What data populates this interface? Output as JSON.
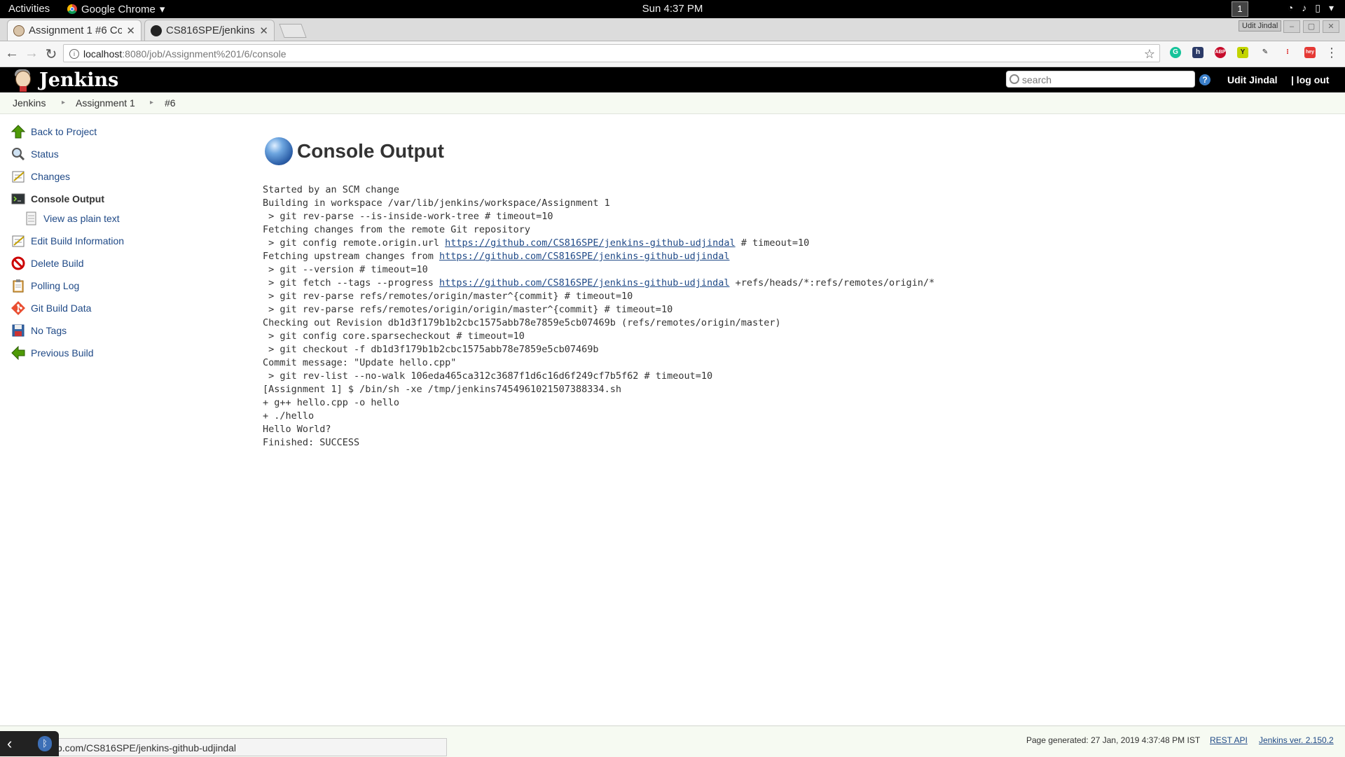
{
  "os_topbar": {
    "activities": "Activities",
    "app_name": "Google Chrome",
    "clock": "Sun  4:37 PM",
    "workspace": "1"
  },
  "browser": {
    "tabs": [
      {
        "title": "Assignment 1 #6 Co",
        "active": true
      },
      {
        "title": "CS816SPE/jenkins-¨",
        "active": false
      }
    ],
    "profile_name": "Udit Jindal",
    "url_host": "localhost",
    "url_path": ":8080/job/Assignment%201/6/console"
  },
  "jenkins_header": {
    "title": "Jenkins",
    "search_placeholder": "search",
    "help": "?",
    "user": "Udit Jindal",
    "logout": "| log out"
  },
  "breadcrumb": [
    "Jenkins",
    "Assignment 1",
    "#6"
  ],
  "side_panel": {
    "items": [
      {
        "label": "Back to Project",
        "icon": "up-arrow-icon"
      },
      {
        "label": "Status",
        "icon": "magnifier-icon"
      },
      {
        "label": "Changes",
        "icon": "notepad-icon"
      },
      {
        "label": "Console Output",
        "icon": "terminal-icon"
      },
      {
        "label": "View as plain text",
        "icon": "document-icon"
      },
      {
        "label": "Edit Build Information",
        "icon": "notepad-icon"
      },
      {
        "label": "Delete Build",
        "icon": "no-entry-icon"
      },
      {
        "label": "Polling Log",
        "icon": "clipboard-icon"
      },
      {
        "label": "Git Build Data",
        "icon": "git-icon"
      },
      {
        "label": "No Tags",
        "icon": "save-icon"
      },
      {
        "label": "Previous Build",
        "icon": "left-arrow-icon"
      }
    ]
  },
  "main": {
    "heading": "Console Output",
    "console_lines": [
      "Started by an SCM change",
      "Building in workspace /var/lib/jenkins/workspace/Assignment 1",
      " > git rev-parse --is-inside-work-tree # timeout=10",
      "Fetching changes from the remote Git repository",
      " > git config remote.origin.url ",
      "https://github.com/CS816SPE/jenkins-github-udjindal",
      " # timeout=10",
      "Fetching upstream changes from ",
      "https://github.com/CS816SPE/jenkins-github-udjindal",
      " > git --version # timeout=10",
      " > git fetch --tags --progress ",
      "https://github.com/CS816SPE/jenkins-github-udjindal",
      " +refs/heads/*:refs/remotes/origin/*",
      " > git rev-parse refs/remotes/origin/master^{commit} # timeout=10",
      " > git rev-parse refs/remotes/origin/origin/master^{commit} # timeout=10",
      "Checking out Revision db1d3f179b1b2cbc1575abb78e7859e5cb07469b (refs/remotes/origin/master)",
      " > git config core.sparsecheckout # timeout=10",
      " > git checkout -f db1d3f179b1b2cbc1575abb78e7859e5cb07469b",
      "Commit message: \"Update hello.cpp\"",
      " > git rev-list --no-walk 106eda465ca312c3687f1d6c16d6f249cf7b5f62 # timeout=10",
      "[Assignment 1] $ /bin/sh -xe /tmp/jenkins7454961021507388334.sh",
      "+ g++ hello.cpp -o hello",
      "+ ./hello",
      "Hello World?",
      "Finished: SUCCESS"
    ]
  },
  "footer": {
    "generated": "Page generated: 27 Jan, 2019 4:37:48 PM IST",
    "rest_api": "REST API",
    "version": "Jenkins ver. 2.150.2"
  },
  "status_bubble": "b.com/CS816SPE/jenkins-github-udjindal"
}
